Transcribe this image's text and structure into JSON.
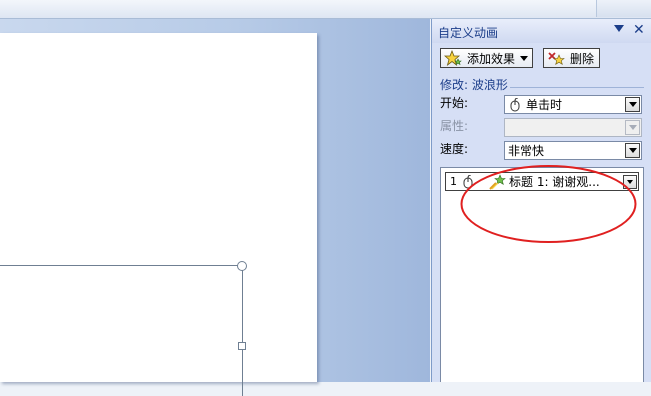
{
  "task_pane": {
    "title": "自定义动画",
    "add_effect_label": "添加效果",
    "remove_label": "删除",
    "modify_label": "修改: 波浪形",
    "start_label": "开始:",
    "start_value": "单击时",
    "property_label": "属性:",
    "property_value": "",
    "speed_label": "速度:",
    "speed_value": "非常快",
    "animations": [
      {
        "order": "1",
        "text": "标题 1: 谢谢观..."
      }
    ]
  },
  "colors": {
    "pane_title": "#1c3e8a",
    "pane_background": "#d6dff5",
    "highlight_ellipse": "#e02020",
    "slide_background": "#ffffff"
  },
  "icons": {
    "add_effect": "star-icon",
    "remove": "remove-effect-icon",
    "start_trigger": "mouse-icon",
    "animation_type": "star-effect-icon"
  }
}
